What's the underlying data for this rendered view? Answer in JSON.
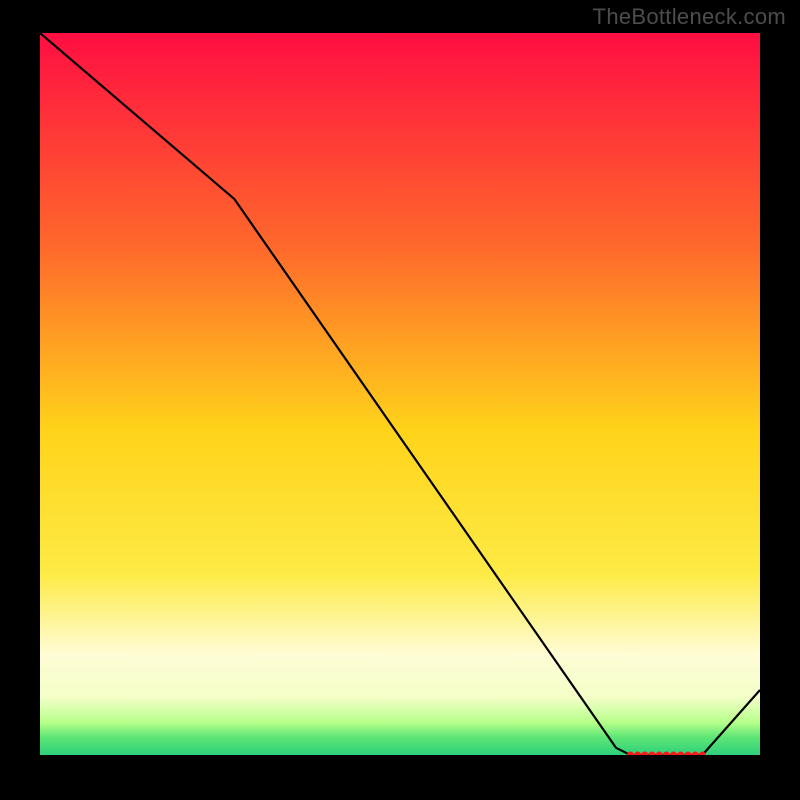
{
  "watermark": "TheBottleneck.com",
  "colors": {
    "bg": "#000000",
    "watermark": "#4d4d4d",
    "line": "#000000",
    "marker": "#ff1a1a",
    "gradient_stops": [
      {
        "offset": 0.0,
        "color": "#ff0e42"
      },
      {
        "offset": 0.3,
        "color": "#ff6a2b"
      },
      {
        "offset": 0.55,
        "color": "#ffd31a"
      },
      {
        "offset": 0.75,
        "color": "#feeb46"
      },
      {
        "offset": 0.86,
        "color": "#fffcd5"
      },
      {
        "offset": 0.92,
        "color": "#f4ffc8"
      },
      {
        "offset": 0.955,
        "color": "#b6ff8a"
      },
      {
        "offset": 0.975,
        "color": "#5fe676"
      },
      {
        "offset": 1.0,
        "color": "#2dd07a"
      }
    ]
  },
  "chart_data": {
    "type": "line",
    "xlabel": "",
    "ylabel": "",
    "title": "",
    "xlim": [
      0,
      100
    ],
    "ylim": [
      0,
      100
    ],
    "x": [
      0,
      27,
      80,
      82,
      83,
      84,
      85,
      86,
      87,
      88,
      89,
      90,
      91,
      92,
      100
    ],
    "y": [
      100,
      77,
      1,
      0,
      0,
      0,
      0,
      0,
      0,
      0,
      0,
      0,
      0,
      0,
      9
    ],
    "markers": {
      "x": [
        82,
        83,
        84,
        85,
        86,
        87,
        88,
        89,
        90,
        91,
        92
      ],
      "y": [
        0,
        0,
        0,
        0,
        0,
        0,
        0,
        0,
        0,
        0,
        0
      ]
    }
  }
}
